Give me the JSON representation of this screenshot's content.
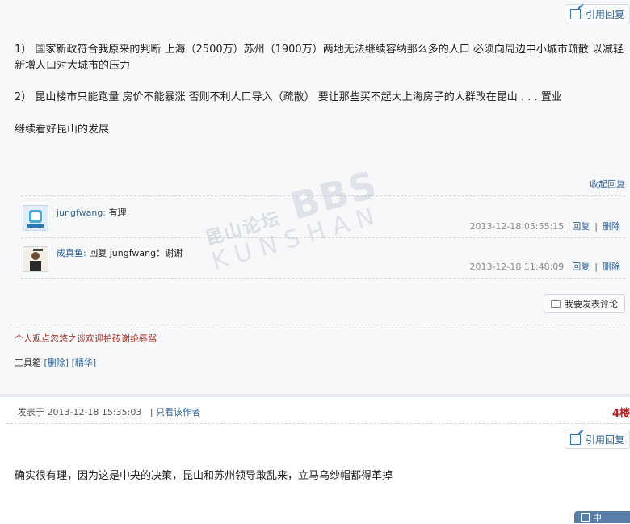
{
  "post1": {
    "quote_label": "引用回复",
    "paragraphs": [
      "1） 国家新政符合我原来的判断 上海（2500万）苏州（1900万）两地无法继续容纳那么多的人口 必须向周边中小城市疏散 以减轻新增人口对大城市的压力",
      "2） 昆山楼市只能跑量 房价不能暴涨 否则不利人口导入（疏散） 要让那些买不起大上海房子的人群改在昆山 . . . 置业",
      "继续看好昆山的发展"
    ],
    "fold_label": "收起回复",
    "comments": [
      {
        "user": "jungfwang:",
        "text": "有理",
        "time": "2013-12-18 05:55:15",
        "reply": "回复",
        "sep": "|",
        "delete": "删除"
      },
      {
        "user": "成真鱼:",
        "text": "回复 jungfwang：谢谢",
        "time": "2013-12-18 11:48:09",
        "reply": "回复",
        "sep": "|",
        "delete": "删除"
      }
    ],
    "comment_button": "我要发表评论",
    "signature": "个人观点忽悠之谈欢迎拍砖谢绝辱骂",
    "toolbox": {
      "label": "工具箱",
      "delete": "[删除]",
      "essence": "[精华]"
    }
  },
  "watermark": {
    "cn": "昆山论坛",
    "big": "BBS",
    "en": "KUNSHAN"
  },
  "post2": {
    "posted_at": "发表于 2013-12-18 15:35:03",
    "sep": "|",
    "only_author": "只看该作者",
    "floor": "4楼",
    "quote_label": "引用回复",
    "text": "确实很有理，因为这是中央的决策，昆山和苏州领导敢乱来，立马乌纱帽都得革掉"
  },
  "corner_widget": {
    "label": "中"
  },
  "colors": {
    "link": "#336699",
    "signature": "#a3342a",
    "floor": "#b22222",
    "panel": "#f6f8fa"
  },
  "icons": [
    "quote-reply-icon",
    "comment-icon",
    "avatar"
  ]
}
